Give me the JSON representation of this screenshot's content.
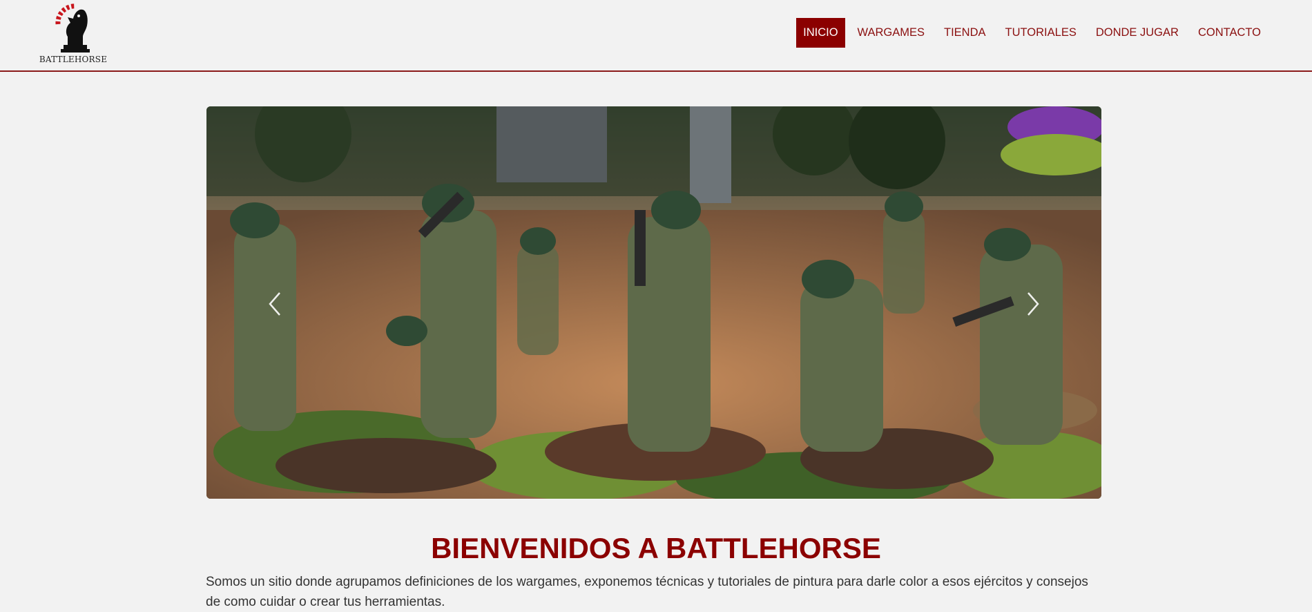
{
  "brand": {
    "name": "BATTLEHORSE",
    "logo_icon": "knight-chess-piece-icon",
    "colors": {
      "accent": "#8b0000",
      "text": "#333333",
      "background": "#f2f2f2"
    }
  },
  "nav": {
    "items": [
      {
        "label": "INICIO",
        "active": true
      },
      {
        "label": "WARGAMES",
        "active": false
      },
      {
        "label": "TIENDA",
        "active": false
      },
      {
        "label": "TUTORIALES",
        "active": false
      },
      {
        "label": "DONDE JUGAR",
        "active": false
      },
      {
        "label": "CONTACTO",
        "active": false
      }
    ]
  },
  "carousel": {
    "prev_icon": "chevron-left-icon",
    "next_icon": "chevron-right-icon"
  },
  "main": {
    "title": "BIENVENIDOS A BATTLEHORSE",
    "intro": "Somos un sitio donde agrupamos definiciones de los wargames, exponemos técnicas y tutoriales de pintura para darle color a esos ejércitos y consejos de como cuidar o crear tus herramientas."
  }
}
